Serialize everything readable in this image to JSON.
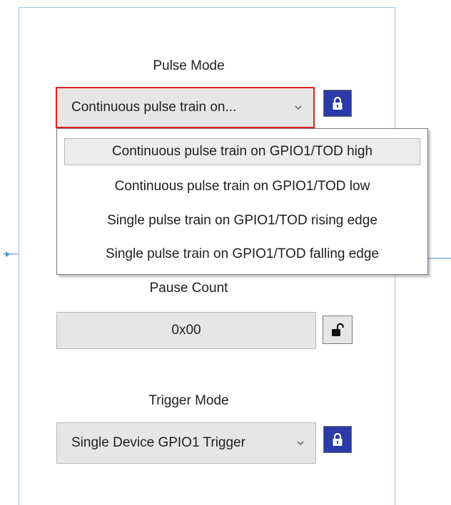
{
  "pulse_mode": {
    "label": "Pulse Mode",
    "selected": "Continuous pulse train on...",
    "options": [
      "Continuous pulse train on GPIO1/TOD high",
      "Continuous pulse train on GPIO1/TOD low",
      "Single pulse train on GPIO1/TOD rising edge",
      "Single pulse train on GPIO1/TOD falling edge"
    ],
    "selected_index": 0,
    "lock_icon": "lock-closed-icon",
    "locked": true
  },
  "pause_count": {
    "label": "Pause Count",
    "value": "0x00",
    "lock_icon": "lock-open-icon",
    "locked": false
  },
  "trigger_mode": {
    "label": "Trigger Mode",
    "selected": "Single Device GPIO1 Trigger",
    "lock_icon": "lock-closed-icon",
    "locked": true
  },
  "colors": {
    "lock_locked_bg": "#2a3aa8",
    "focus_border": "#e02020",
    "connector": "#4a90d9",
    "panel_border": "#a9c4e2"
  }
}
